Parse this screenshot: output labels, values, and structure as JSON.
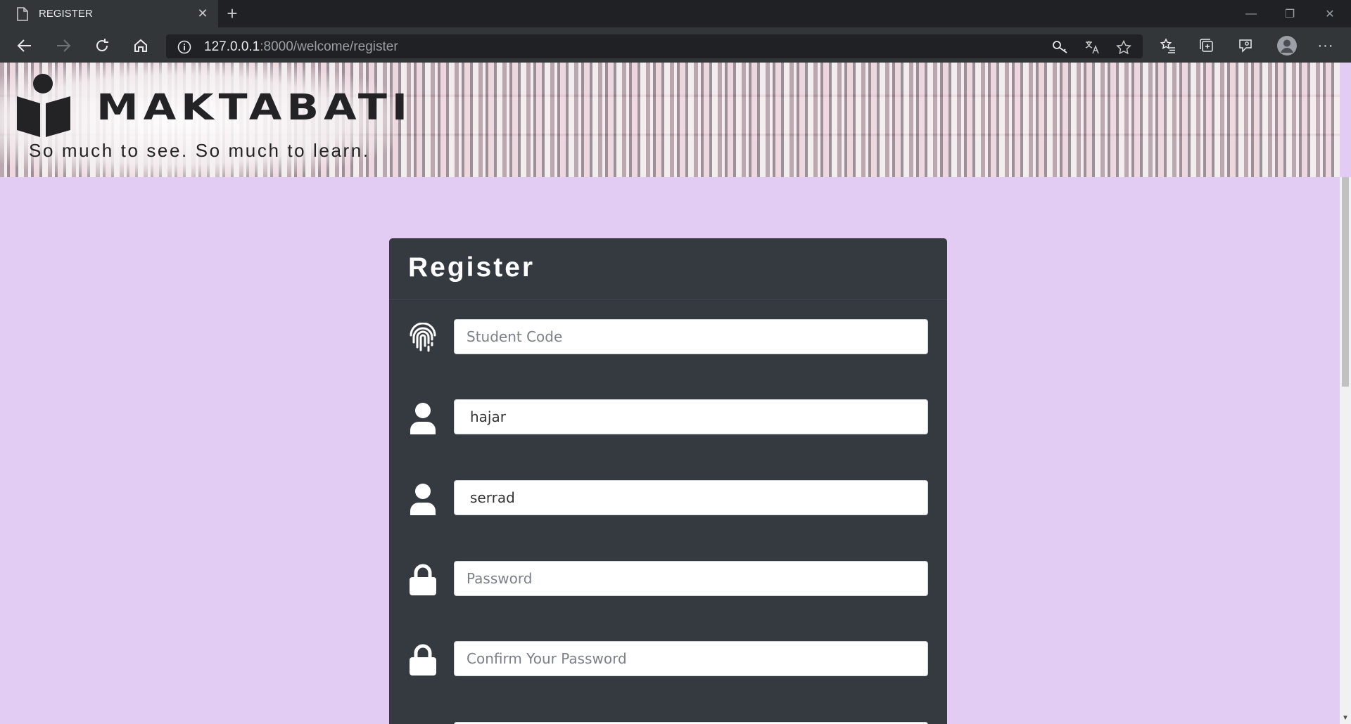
{
  "browser": {
    "tab_title": "REGISTER",
    "url_host": "127.0.0.1",
    "url_rest": ":8000/welcome/register"
  },
  "banner": {
    "logo_text": "MAKTABATI",
    "tagline": "So much to see. So much to learn."
  },
  "form": {
    "title": "Register",
    "fields": [
      {
        "icon": "fingerprint-icon",
        "value": "",
        "placeholder": "Student Code"
      },
      {
        "icon": "user-icon",
        "value": "hajar",
        "placeholder": ""
      },
      {
        "icon": "user-icon",
        "value": "serrad",
        "placeholder": ""
      },
      {
        "icon": "lock-icon",
        "value": "",
        "placeholder": "Password"
      },
      {
        "icon": "lock-icon",
        "value": "",
        "placeholder": "Confirm Your Password"
      }
    ]
  },
  "colors": {
    "page_bg": "#e2ccf3",
    "card_bg": "#343a40",
    "browser_bg": "#323639"
  }
}
